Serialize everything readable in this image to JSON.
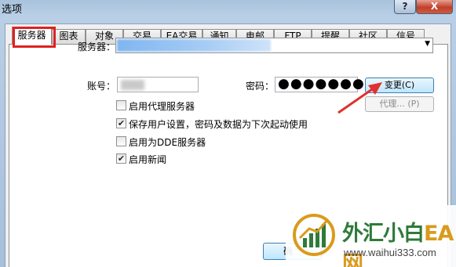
{
  "window": {
    "title": "选项",
    "help_label": "?",
    "close_label": "X"
  },
  "tabs": [
    {
      "label": "服务器"
    },
    {
      "label": "图表"
    },
    {
      "label": "对象"
    },
    {
      "label": "交易"
    },
    {
      "label": "EA交易"
    },
    {
      "label": "通知"
    },
    {
      "label": "电邮"
    },
    {
      "label": "FTP"
    },
    {
      "label": "提醒"
    },
    {
      "label": "社区"
    },
    {
      "label": "信号"
    }
  ],
  "server": {
    "label": "服务器：",
    "dropdown_arrow": "▼"
  },
  "account": {
    "label": "账号：",
    "password_label": "密码：",
    "password_value": "●●●●●●●"
  },
  "buttons": {
    "change": "变更(C)",
    "proxy": "代理... (P)",
    "ok": "确"
  },
  "options": [
    {
      "label": "启用代理服务器",
      "checked": false
    },
    {
      "label": "保存用户设置，密码及数据为下次起动使用",
      "checked": true
    },
    {
      "label": "启用为DDE服务器",
      "checked": false
    },
    {
      "label": "启用新闻",
      "checked": true
    }
  ],
  "watermark": {
    "text_main": "外汇小白",
    "text_ea": "EA网",
    "url": "www.waihui333.com"
  },
  "colors": {
    "highlight_red": "#e02020",
    "arrow_red": "#e03030"
  }
}
